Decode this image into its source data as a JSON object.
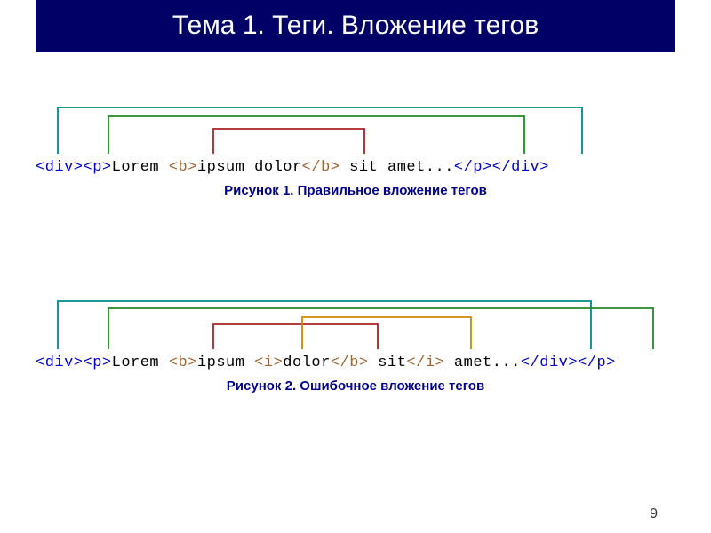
{
  "header": {
    "title": "Тема 1. Теги. Вложение тегов"
  },
  "figure1": {
    "caption": "Рисунок 1. Правильное вложение тегов",
    "tokens": {
      "t0": "<div>",
      "t1": "<p>",
      "t2": "Lorem ",
      "t3": "<b>",
      "t4": "ipsum dolor",
      "t5": "</b>",
      "t6": " sit amet...",
      "t7": "</p>",
      "t8": "</div>"
    }
  },
  "figure2": {
    "caption": "Рисунок 2. Ошибочное вложение тегов",
    "tokens": {
      "t0": "<div>",
      "t1": "<p>",
      "t2": "Lorem ",
      "t3": "<b>",
      "t4": "ipsum ",
      "t5": "<i>",
      "t6": "dolor",
      "t7": "</b>",
      "t8": " sit",
      "t9": "</i>",
      "t10": " amet...",
      "t11": "</div>",
      "t12": "</p>"
    }
  },
  "pageNumber": "9"
}
